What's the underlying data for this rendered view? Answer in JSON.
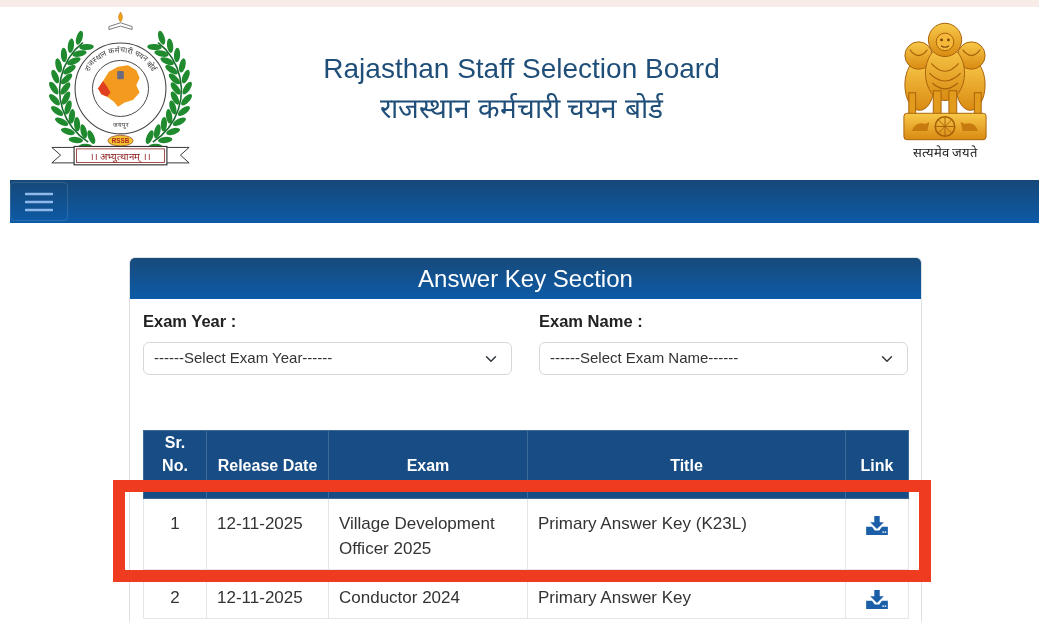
{
  "header": {
    "logo": {
      "ring_text": "राजस्थान कर्मचारी चयन बोर्ड",
      "city": "जयपुर",
      "badge": "RSSB",
      "motto": "।। अभ्युत्थानम् ।।"
    },
    "title": "Rajasthan Staff Selection Board",
    "title_hindi": "राजस्थान कर्मचारी चयन बोर्ड",
    "emblem_caption": "सत्यमेव जयते"
  },
  "section": {
    "title": "Answer Key Section",
    "filters": [
      {
        "label": "Exam Year :",
        "value": "------Select Exam Year------"
      },
      {
        "label": "Exam Name :",
        "value": "------Select Exam Name------"
      }
    ],
    "table": {
      "columns": [
        "Sr. No.",
        "Release Date",
        "Exam",
        "Title",
        "Link"
      ],
      "rows": [
        {
          "cells": [
            "1",
            "12-11-2025",
            "Village Development Officer 2025",
            "Primary Answer Key (K23L)"
          ],
          "highlighted": true
        },
        {
          "cells": [
            "2",
            "12-11-2025",
            "Conductor 2024",
            "Primary Answer Key"
          ],
          "highlighted": false
        }
      ]
    }
  }
}
